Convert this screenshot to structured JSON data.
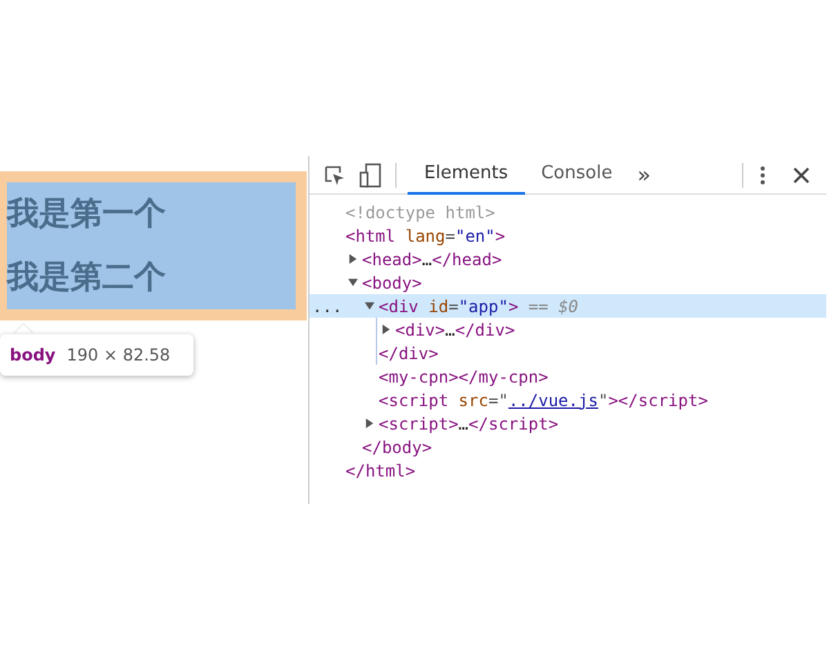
{
  "page": {
    "lines": [
      "我是第一个",
      "我是第二个"
    ],
    "tooltip": {
      "tag": "body",
      "size": "190 × 82.58"
    }
  },
  "devtools": {
    "tabs": [
      {
        "label": "Elements",
        "selected": true
      },
      {
        "label": "Console",
        "selected": false
      }
    ],
    "more": "»",
    "dom": [
      {
        "tokens": [
          {
            "kind": "comment",
            "text": "<!doctype html>"
          }
        ]
      },
      {
        "tokens": [
          {
            "kind": "tag",
            "text": "<html"
          },
          {
            "kind": "attr",
            "text": " lang"
          },
          {
            "kind": "punct",
            "text": "="
          },
          {
            "kind": "value",
            "text": "\"en\""
          },
          {
            "kind": "tag",
            "text": ">"
          }
        ],
        "children": [
          {
            "expanded": false,
            "tokens": [
              {
                "kind": "tag",
                "text": "<head>"
              },
              {
                "kind": "text",
                "text": "…"
              },
              {
                "kind": "tag",
                "text": "</head>"
              }
            ]
          },
          {
            "expanded": true,
            "tokens": [
              {
                "kind": "tag",
                "text": "<body>"
              }
            ],
            "children": [
              {
                "expanded": true,
                "selected": true,
                "gutter": "...",
                "tokens": [
                  {
                    "kind": "tag",
                    "text": "<div"
                  },
                  {
                    "kind": "attr",
                    "text": " id"
                  },
                  {
                    "kind": "punct",
                    "text": "="
                  },
                  {
                    "kind": "value",
                    "text": "\"app\""
                  },
                  {
                    "kind": "tag",
                    "text": ">"
                  },
                  {
                    "kind": "note",
                    "text": " == $0"
                  }
                ],
                "children": [
                  {
                    "expanded": false,
                    "selected": false,
                    "tokens": [
                      {
                        "kind": "tag",
                        "text": "<div>"
                      },
                      {
                        "kind": "text",
                        "text": "…"
                      },
                      {
                        "kind": "tag",
                        "text": "</div>"
                      }
                    ]
                  }
                ],
                "closing": [
                  {
                    "kind": "tag",
                    "text": "</div>"
                  }
                ]
              },
              {
                "selected": false,
                "tokens": [
                  {
                    "kind": "tag",
                    "text": "<my-cpn></my-cpn>"
                  }
                ]
              },
              {
                "selected": false,
                "tokens": [
                  {
                    "kind": "tag",
                    "text": "<script"
                  },
                  {
                    "kind": "attr",
                    "text": " src"
                  },
                  {
                    "kind": "punct",
                    "text": "=\""
                  },
                  {
                    "kind": "link",
                    "text": "../vue.js"
                  },
                  {
                    "kind": "punct",
                    "text": "\""
                  },
                  {
                    "kind": "tag",
                    "text": "></script>"
                  }
                ]
              },
              {
                "expanded": false,
                "selected": false,
                "tokens": [
                  {
                    "kind": "tag",
                    "text": "<script>"
                  },
                  {
                    "kind": "text",
                    "text": "…"
                  },
                  {
                    "kind": "tag",
                    "text": "</script>"
                  }
                ]
              }
            ],
            "closing": [
              {
                "kind": "tag",
                "text": "</body>"
              }
            ]
          }
        ],
        "closing": [
          {
            "kind": "tag",
            "text": "</html>"
          }
        ]
      }
    ]
  }
}
